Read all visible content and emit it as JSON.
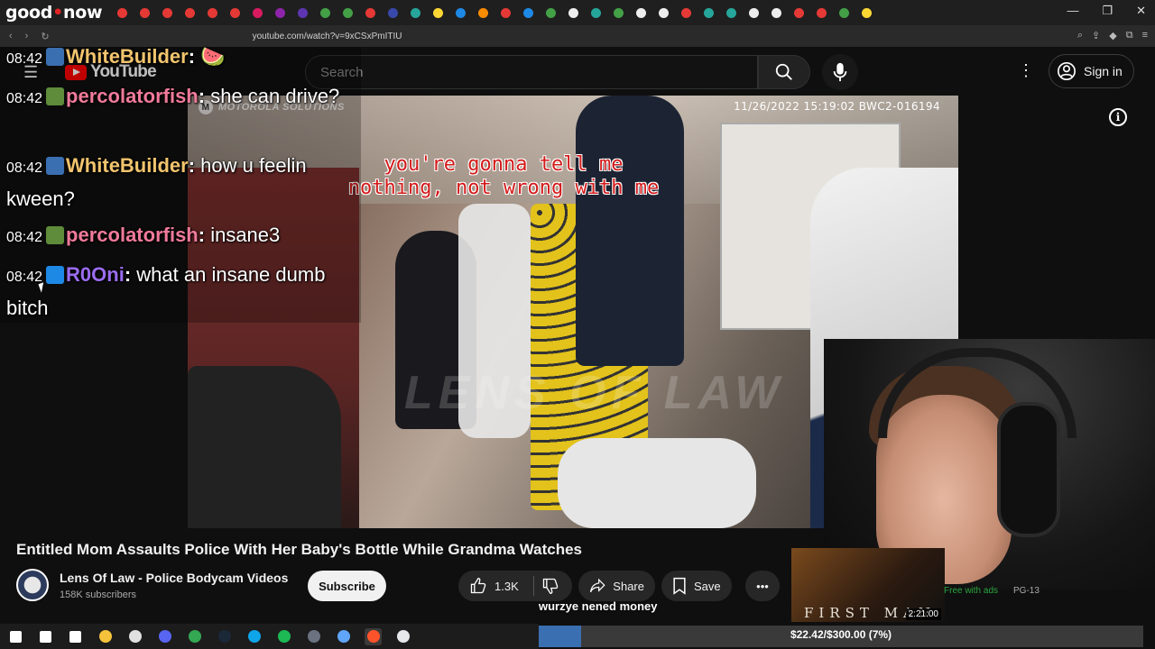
{
  "browser": {
    "stream_title_a": "good",
    "stream_title_b": "now",
    "url": "youtube.com/watch?v=9xCSxPmITIU",
    "tab_colors": [
      "#e53935",
      "#e53935",
      "#e53935",
      "#e53935",
      "#e53935",
      "#e53935",
      "#d81b60",
      "#8e24aa",
      "#5e35b1",
      "#43a047",
      "#43a047",
      "#e53935",
      "#3949ab",
      "#26a69a",
      "#fdd835",
      "#1e88e5",
      "#fb8c00",
      "#e53935",
      "#1e88e5",
      "#43a047",
      "#eeeeee",
      "#26a69a",
      "#43a047",
      "#eeeeee",
      "#eeeeee",
      "#e53935",
      "#26a69a",
      "#26a69a",
      "#eeeeee",
      "#eeeeee",
      "#e53935",
      "#e53935",
      "#43a047",
      "#fdd835"
    ],
    "window_controls": [
      "—",
      "❐",
      "✕"
    ]
  },
  "youtube": {
    "logo_text": "YouTube",
    "search_placeholder": "Search",
    "sign_in": "Sign in"
  },
  "video": {
    "brand_watermark": "MOTOROLA SOLUTIONS",
    "timestamp_stamp": "11/26/2022 15:19:02 BWC2-016194",
    "subtitle": "you're gonna tell me nothing, not wrong with me",
    "lens_watermark": "LENS OF LAW",
    "title": "Entitled Mom Assaults Police With Her Baby's Bottle While Grandma Watches"
  },
  "channel": {
    "name": "Lens Of Law - Police Bodycam Videos",
    "subscribers": "158K subscribers",
    "subscribe_label": "Subscribe"
  },
  "actions": {
    "like_count": "1.3K",
    "share_label": "Share",
    "save_label": "Save"
  },
  "chat": [
    {
      "time": "08:42",
      "user": "WhiteBuilder",
      "user_color": "#f2c46d",
      "badge_color": "#3a6fb1",
      "text": "🍉"
    },
    {
      "time": "08:42",
      "user": "percolatorfish",
      "user_color": "#f07a9a",
      "badge_color": "#5e8c3a",
      "text": "she can drive?"
    },
    {
      "time": "08:42",
      "user": "WhiteBuilder",
      "user_color": "#f2c46d",
      "badge_color": "#3a6fb1",
      "text": "how u feelin kween?"
    },
    {
      "time": "08:42",
      "user": "percolatorfish",
      "user_color": "#f07a9a",
      "badge_color": "#5e8c3a",
      "text": "insane3"
    },
    {
      "time": "08:42",
      "user": "R0Oni",
      "user_color": "#9b6cf0",
      "badge_color": "#1e88e5",
      "text": "what an insane dumb bitch"
    }
  ],
  "side_video": {
    "thumb_title": "FIRST MAN",
    "duration": "2:21:00",
    "free_label": "Free with ads",
    "rating": "PG-13"
  },
  "donation": {
    "goal_message": "wurzye nened money",
    "amount_label": "$22.42/$300.00 (7%)",
    "progress_fraction": 0.07,
    "bar_color": "#3a6fb1"
  },
  "taskbar": {
    "icons": [
      "windows-start",
      "search",
      "task-view",
      "file-explorer",
      "obs",
      "discord",
      "chrome",
      "steam",
      "edge",
      "spotify",
      "obs-studio",
      "notepad",
      "brave",
      "paint"
    ],
    "icon_colors": [
      "#ffffff",
      "#ffffff",
      "#ffffff",
      "#f5c33b",
      "#e0e0e0",
      "#5865f2",
      "#34a853",
      "#1b2838",
      "#0ea5e9",
      "#1db954",
      "#6b7280",
      "#60a5fa",
      "#fb542b",
      "#e5e7eb"
    ]
  }
}
